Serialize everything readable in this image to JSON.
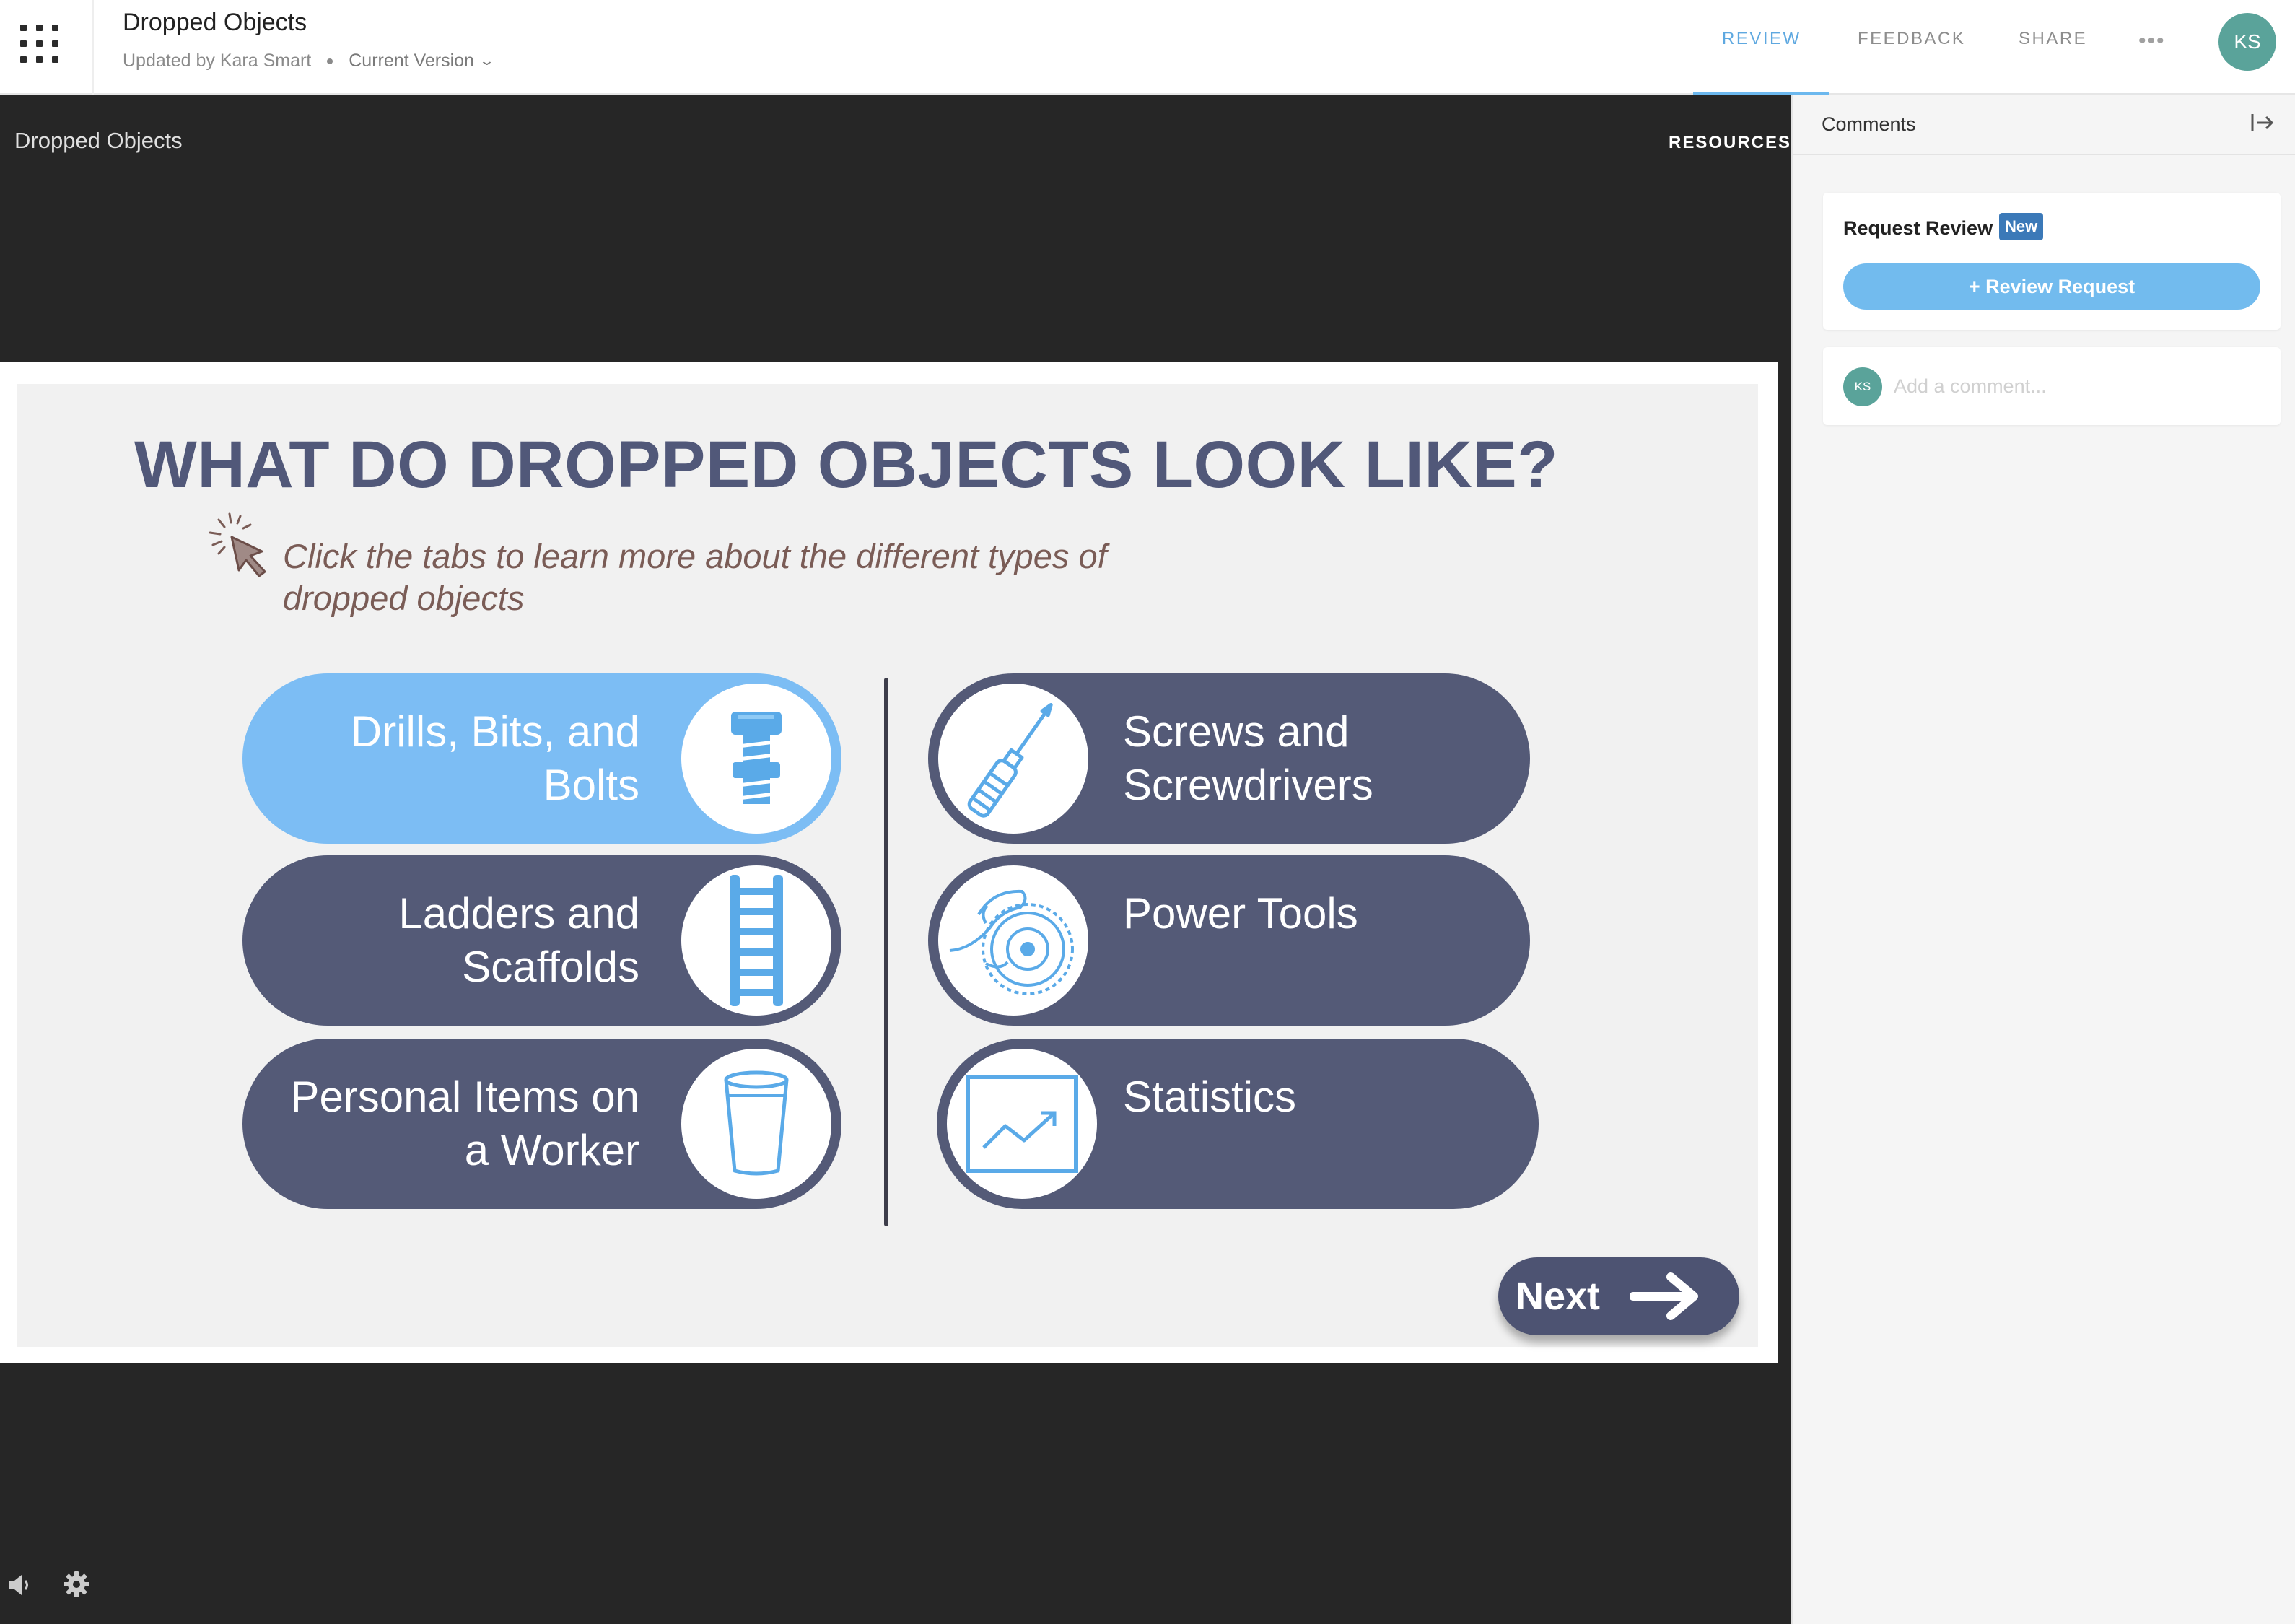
{
  "header": {
    "title": "Dropped Objects",
    "updated_by": "Updated by Kara Smart",
    "version": "Current Version",
    "tabs": [
      {
        "label": "REVIEW",
        "active": true
      },
      {
        "label": "FEEDBACK",
        "active": false
      },
      {
        "label": "SHARE",
        "active": false
      }
    ],
    "more_label": "•••",
    "avatar_initials": "KS"
  },
  "player": {
    "title": "Dropped Objects",
    "resources_label": "RESOURCES"
  },
  "slide": {
    "heading": "WHAT DO DROPPED OBJECTS LOOK LIKE?",
    "instruction": "Click the tabs to learn more about the different types of dropped objects",
    "tabs_left": [
      {
        "label": "Drills, Bits, and Bolts",
        "icon": "bolt-icon",
        "active": true
      },
      {
        "label": "Ladders and Scaffolds",
        "icon": "ladder-icon",
        "active": false
      },
      {
        "label": "Personal Items on a Worker",
        "icon": "cup-icon",
        "active": false
      }
    ],
    "tabs_right": [
      {
        "label": "Screws and Screwdrivers",
        "icon": "screwdriver-icon",
        "active": false
      },
      {
        "label": "Power Tools",
        "icon": "circular-saw-icon",
        "active": false
      },
      {
        "label": "Statistics",
        "icon": "trend-chart-icon",
        "active": false
      }
    ],
    "next_label": "Next"
  },
  "comments": {
    "title": "Comments",
    "request_title": "Request Review",
    "new_badge": "New",
    "review_button": "+ Review Request",
    "avatar_initials": "KS",
    "placeholder": "Add a comment..."
  },
  "colors": {
    "accent_blue": "#7cbdf4",
    "tab_navy": "#545a77",
    "heading_navy": "#515879",
    "avatar_teal": "#5aa39a",
    "badge_blue": "#3b79b8"
  }
}
